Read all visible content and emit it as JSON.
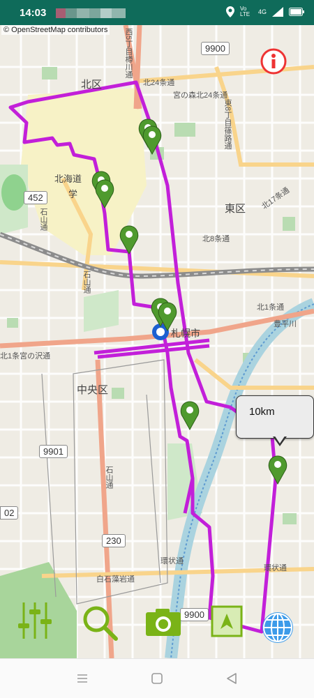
{
  "status_bar": {
    "time": "14:03",
    "network": "4G",
    "volte": "Vo LTE",
    "icons": [
      "location-icon",
      "volte-icon",
      "signal-icon",
      "battery-icon"
    ]
  },
  "map": {
    "attribution": "© OpenStreetMap contributors",
    "labels": {
      "kita_ku": "北区",
      "higashi_ku": "東区",
      "chuo_ku": "中央区",
      "hokudai": "北海道",
      "hokudai2": "学",
      "station": "札幌市",
      "kita24": "北24条通",
      "higashi8": "東8丁目篠路通",
      "kita8": "北8条通",
      "kita1": "北1条宮の沢通",
      "kita1b": "北1条通",
      "toyohira": "豊平川",
      "kanjo": "環状通",
      "kanjo2": "環状通",
      "shiraishi": "白石藻岩通",
      "ishiyama": "石山通",
      "ishiyama2": "石山通",
      "ishiyama3": "石山通",
      "nishi5": "西5丁目樽川通",
      "kita17": "北17条通",
      "miyanomori": "宮の森北24条通"
    },
    "shields": {
      "r9900_top": "9900",
      "r452": "452",
      "r9901": "9901",
      "r230": "230",
      "r9900_bottom": "9900",
      "r02": "02"
    },
    "distance_callout": "10km",
    "route_color": "#c21fd9",
    "marker_color": "#4f9a2e"
  },
  "toolbar": {
    "settings": "settings-sliders-icon",
    "search": "search-icon",
    "camera": "camera-icon",
    "compass": "map-compass-icon",
    "globe": "globe-icon"
  }
}
